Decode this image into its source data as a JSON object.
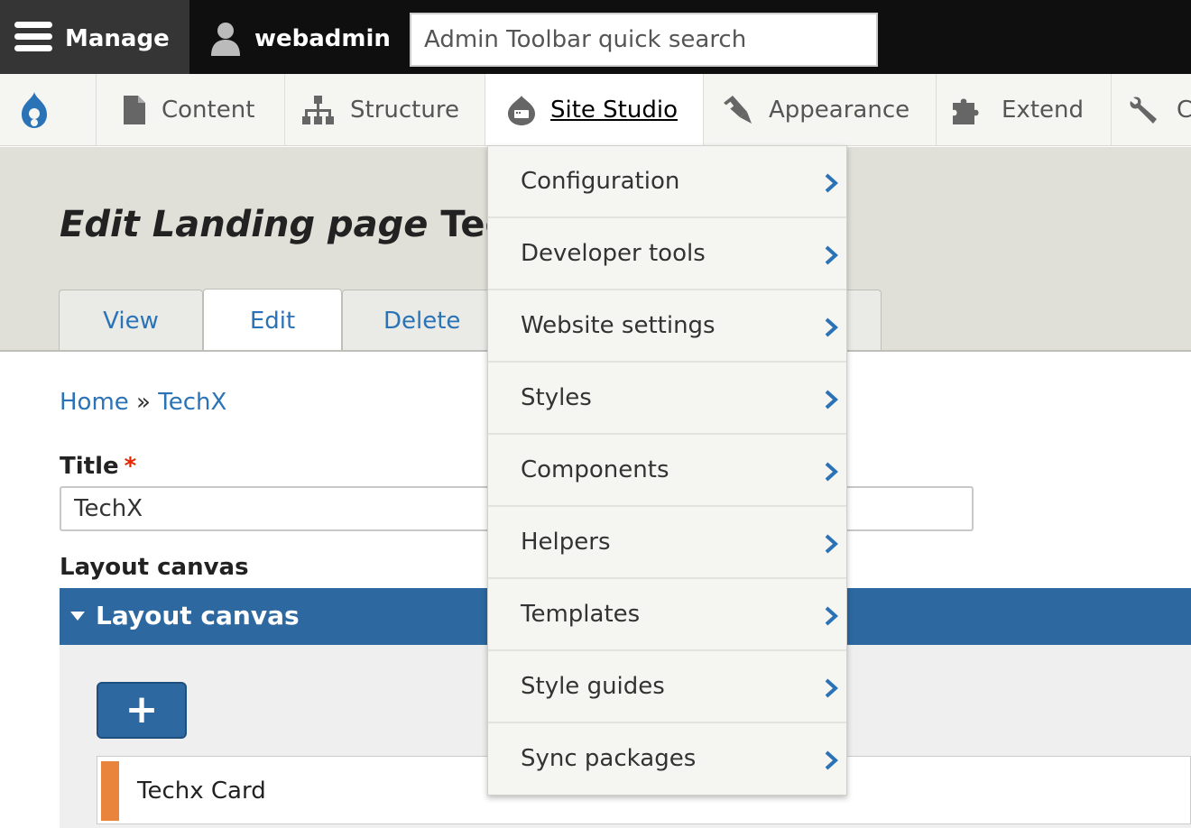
{
  "toolbar": {
    "manage_label": "Manage",
    "user_label": "webadmin",
    "search_placeholder": "Admin Toolbar quick search"
  },
  "tray": {
    "items": [
      {
        "label": "Content",
        "icon": "file-icon"
      },
      {
        "label": "Structure",
        "icon": "sitemap-icon"
      },
      {
        "label": "Site Studio",
        "icon": "site-studio-icon",
        "active": true
      },
      {
        "label": "Appearance",
        "icon": "paintbrush-icon"
      },
      {
        "label": "Extend",
        "icon": "puzzle-icon"
      },
      {
        "label": "C",
        "icon": "wrench-icon"
      }
    ]
  },
  "dropdown": {
    "items": [
      {
        "label": "Configuration"
      },
      {
        "label": "Developer tools"
      },
      {
        "label": "Website settings"
      },
      {
        "label": "Styles"
      },
      {
        "label": "Components"
      },
      {
        "label": "Helpers"
      },
      {
        "label": "Templates"
      },
      {
        "label": "Style guides"
      },
      {
        "label": "Sync packages"
      }
    ]
  },
  "header": {
    "title_prefix": "Edit Landing page",
    "title_suffix": "Tec",
    "tabs": [
      {
        "label": "View"
      },
      {
        "label": "Edit",
        "active": true
      },
      {
        "label": "Delete"
      }
    ]
  },
  "breadcrumb": {
    "home": "Home",
    "separator": "»",
    "current": "TechX"
  },
  "form": {
    "title_label": "Title",
    "required_mark": "*",
    "title_value": "TechX",
    "layout_canvas_label": "Layout canvas",
    "layout_canvas_heading": "Layout canvas",
    "add_button_label": "+",
    "card_label": "Techx Card"
  },
  "colors": {
    "toolbar_bg": "#0f0f0f",
    "manage_bg": "#353535",
    "link_blue": "#2a73b6",
    "canvas_blue": "#2d68a0",
    "card_accent": "#e8843c",
    "required_red": "#e62600"
  }
}
